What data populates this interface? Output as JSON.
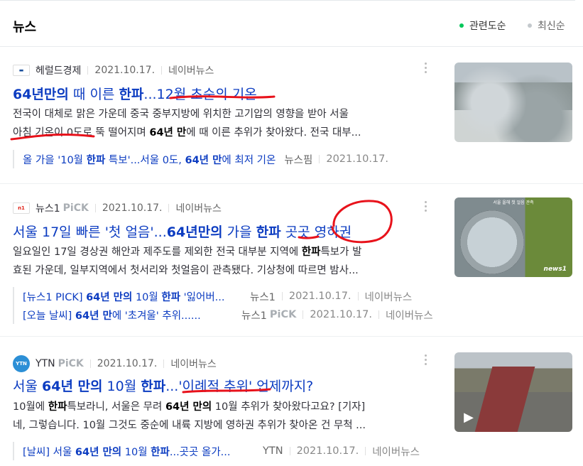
{
  "header": {
    "title": "뉴스",
    "sort_relevance": "관련도순",
    "sort_recent": "최신순",
    "colors": {
      "active_dot": "#03c75a",
      "inactive_dot": "#c4c9cd",
      "link": "#0c3cc1"
    }
  },
  "articles": [
    {
      "press": "헤럴드경제",
      "date": "2021.10.17.",
      "naver": "네이버뉴스",
      "title_b1": "64년만의",
      "title_t1": " 때 이른 ",
      "title_b2": "한파",
      "title_t2": "...12월 초순의 기온",
      "desc1": "전국이 대체로 맑은 가운데 중국 중부지방에 위치한 고기압의 영향을 받아 서울",
      "desc2a": "아침 기온이 0도로 뚝 떨어지며 ",
      "desc2b": "64년 만",
      "desc2c": "에 때 이른 추위가 찾아왔다. 전국 대부...",
      "related": [
        {
          "t1": "올 가을 '10월 ",
          "b1": "한파",
          "t2": " 특보'...서울 0도, ",
          "b2": "64년 만",
          "t3": "에 최저 기온",
          "press": "뉴스핌",
          "date": "2021.10.17."
        }
      ]
    },
    {
      "press": "뉴스1",
      "pick": "PiCK",
      "date": "2021.10.17.",
      "naver": "네이버뉴스",
      "title_t1": "서울 17일 빠른 '첫 얼음'...",
      "title_b1": "64년만의",
      "title_t2": " 가을 ",
      "title_b2": "한파",
      "title_t3": " 곳곳 영하권",
      "desc1a": "일요일인 17일 경상권 해안과 제주도를 제외한 전국 대부분 지역에 ",
      "desc1b": "한파",
      "desc1c": "특보가 발",
      "desc2": "효된 가운데, 일부지역에서 첫서리와 첫얼음이 관측됐다. 기상청에 따르면 밤사...",
      "related": [
        {
          "t1": "[뉴스1 PICK] ",
          "b1": "64년 만의",
          "t2": " 10월 ",
          "b2": "한파",
          "t3": " '잃어버...",
          "press": "뉴스1",
          "date": "2021.10.17.",
          "naver": "네이버뉴스"
        },
        {
          "t1": "[오늘 날씨] ",
          "b1": "64년 만",
          "t2": "에 '초겨울' 추위......",
          "press": "뉴스1",
          "pick": "PiCK",
          "date": "2021.10.17.",
          "naver": "네이버뉴스"
        }
      ],
      "thumb_caption": "서울 올해 첫 얼음 관측",
      "thumb_logo": "news1"
    },
    {
      "press": "YTN",
      "pick": "PiCK",
      "date": "2021.10.17.",
      "naver": "네이버뉴스",
      "title_t1": "서울 ",
      "title_b1": "64년 만의",
      "title_t2": " 10월 ",
      "title_b2": "한파",
      "title_t3": "...'이례적 추위' 언제까지?",
      "desc1a": "10월에 ",
      "desc1b": "한파",
      "desc1c": "특보라니, 서울은 무려 ",
      "desc1d": "64년 만의",
      "desc1e": " 10월 추위가 찾아왔다고요? [기자]",
      "desc2": "네, 그렇습니다. 10월 그것도 중순에 내륙 지방에 영하권 추위가 찾아온 건 무척 ...",
      "related": [
        {
          "t1": "[날씨] 서울 ",
          "b1": "64년 만의",
          "t2": " 10월 ",
          "b2": "한파",
          "t3": "...곳곳 올가...",
          "press": "YTN",
          "date": "2021.10.17.",
          "naver": "네이버뉴스"
        }
      ]
    }
  ]
}
